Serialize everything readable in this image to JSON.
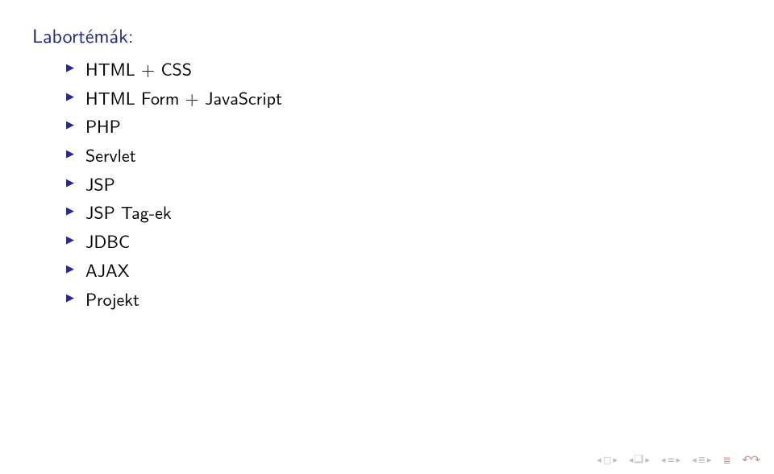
{
  "title": "Labortémák:",
  "items": [
    "HTML + CSS",
    "HTML Form + JavaScript",
    "PHP",
    "Servlet",
    "JSP",
    "JSP Tag-ek",
    "JDBC",
    "AJAX",
    "Projekt"
  ]
}
